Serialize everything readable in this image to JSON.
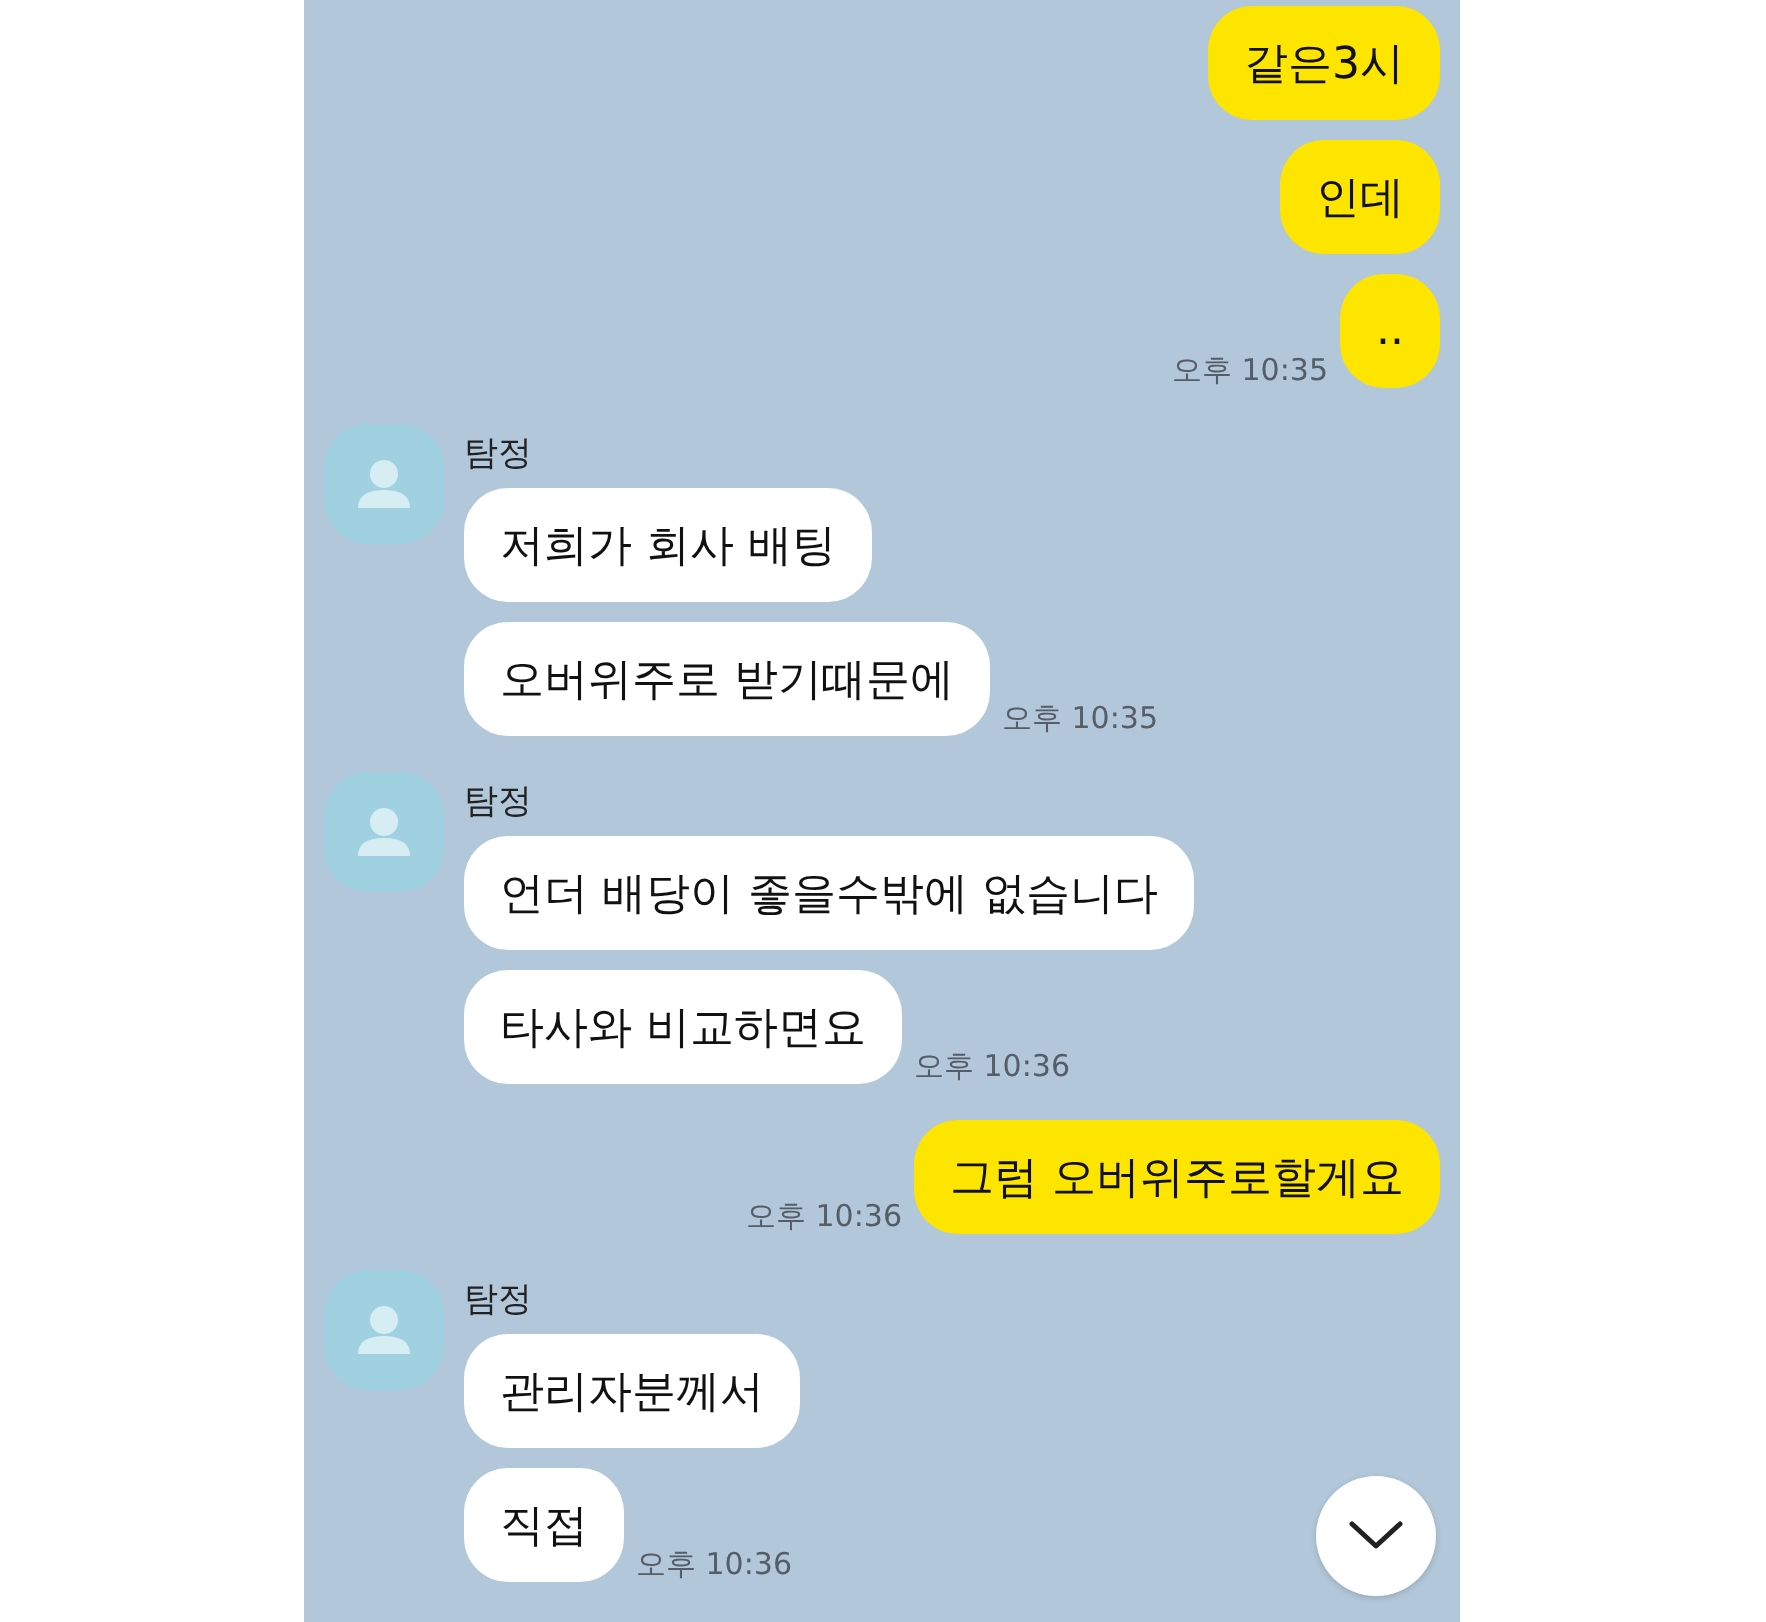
{
  "chat": {
    "groups": [
      {
        "kind": "sent",
        "bubbles": [
          "같은3시",
          "인데",
          ".."
        ],
        "time": "오후 10:35"
      },
      {
        "kind": "received",
        "sender": "탐정",
        "bubbles": [
          "저희가 회사 배팅",
          "오버위주로 받기때문에"
        ],
        "time": "오후 10:35"
      },
      {
        "kind": "received",
        "sender": "탐정",
        "bubbles": [
          "언더 배당이 좋을수밖에 없습니다",
          "타사와 비교하면요"
        ],
        "time": "오후 10:36"
      },
      {
        "kind": "sent",
        "bubbles": [
          "그럼 오버위주로할게요"
        ],
        "time": "오후 10:36"
      },
      {
        "kind": "received",
        "sender": "탐정",
        "bubbles": [
          "관리자분께서",
          "직접"
        ],
        "time": "오후 10:36"
      }
    ]
  }
}
